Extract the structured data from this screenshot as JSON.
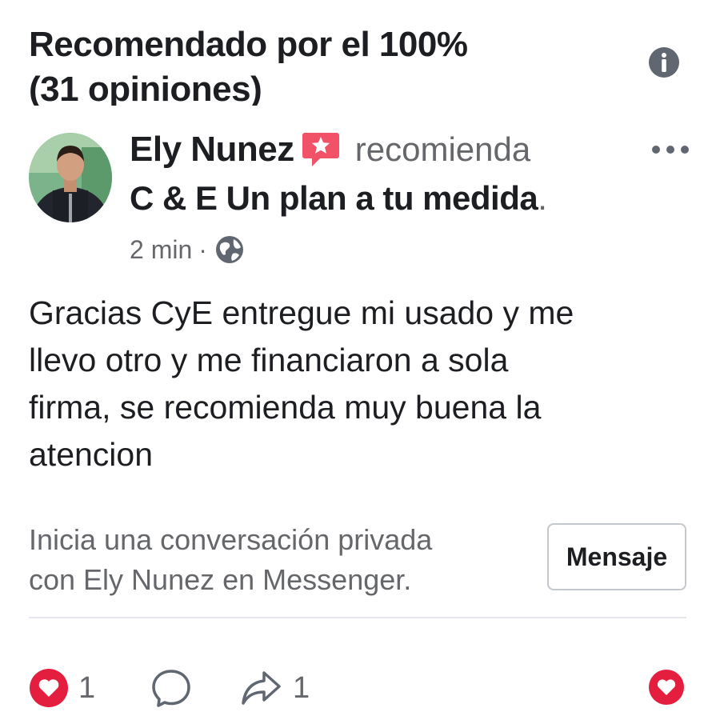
{
  "header": {
    "title_line1": "Recomendado por el 100%",
    "title_line2": "(31 opiniones)",
    "info_icon": "info-icon"
  },
  "post": {
    "author_name": "Ely Nunez",
    "badge_icon": "recommendation-badge-icon",
    "recommends_label": "recomienda",
    "page_name": "C & E Un plan a tu medida",
    "page_name_suffix": ".",
    "time": "2 min",
    "separator": "·",
    "privacy_icon": "globe-icon",
    "more_icon": "more-options-icon",
    "review_lines": [
      "Gracias CyE entregue mi usado y me",
      "llevo otro y me financiaron a sola",
      "firma, se recomienda muy buena la",
      "atencion"
    ]
  },
  "messenger": {
    "prompt_lines": [
      "Inicia una conversación privada",
      "con Ely Nunez en Messenger."
    ],
    "button_label": "Mensaje"
  },
  "actions": {
    "like_count": "1",
    "share_count": "1",
    "like_icon": "heart-icon",
    "comment_icon": "comment-icon",
    "share_icon": "share-icon",
    "react_icon": "heart-react-icon"
  },
  "colors": {
    "heart": "#e41e3f",
    "secondary_text": "#65676b",
    "badge": "#f25268"
  }
}
